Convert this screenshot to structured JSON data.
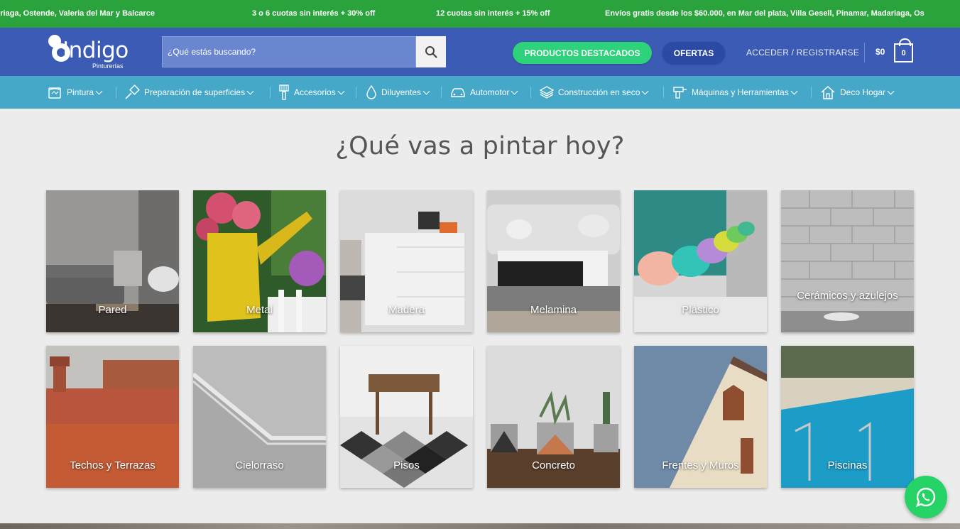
{
  "promo": {
    "items": [
      "rriaga, Ostende, Valeria del Mar y Balcarce",
      "3 o 6 cuotas sin interés + 30% off",
      "12 cuotas sin interés + 15% off",
      "Envíos gratis desde los $60.000, en Mar del plata, Villa Gesell, Pinamar, Madariaga, Os"
    ]
  },
  "header": {
    "logo_text": "Indigo",
    "logo_sub": "Pinturerías",
    "search_placeholder": "¿Qué estás buscando?",
    "featured_label": "PRODUCTOS DESTACADOS",
    "offers_label": "OFERTAS",
    "login_label": "ACCEDER / REGISTRARSE",
    "price": "$0",
    "cart_count": "0"
  },
  "nav": {
    "items": [
      {
        "label": "Pintura",
        "icon": "paint-bucket-icon"
      },
      {
        "label": "Preparación de superficies",
        "icon": "spatula-icon"
      },
      {
        "label": "Accesorios",
        "icon": "brush-icon"
      },
      {
        "label": "Diluyentes",
        "icon": "drop-icon"
      },
      {
        "label": "Automotor",
        "icon": "car-icon"
      },
      {
        "label": "Construcción en seco",
        "icon": "layers-icon"
      },
      {
        "label": "Máquinas y Herramientas",
        "icon": "drill-icon"
      },
      {
        "label": "Deco Hogar",
        "icon": "house-icon"
      }
    ]
  },
  "main": {
    "title": "¿Qué vas a pintar hoy?",
    "tiles": [
      {
        "label": "Pared"
      },
      {
        "label": "Metal"
      },
      {
        "label": "Madera"
      },
      {
        "label": "Melamina"
      },
      {
        "label": "Plástico"
      },
      {
        "label": "Cerámicos y azulejos"
      },
      {
        "label": "Techos y Terrazas"
      },
      {
        "label": "Cielorraso"
      },
      {
        "label": "Pisos"
      },
      {
        "label": "Concreto"
      },
      {
        "label": "Frentes y Muros"
      },
      {
        "label": "Piscinas"
      }
    ]
  },
  "colors": {
    "promo_bg": "#2ba33c",
    "header_bg": "#3b5bb4",
    "nav_bg": "#45a8c8",
    "featured_bg": "#2ed27a",
    "whatsapp": "#25d366"
  }
}
